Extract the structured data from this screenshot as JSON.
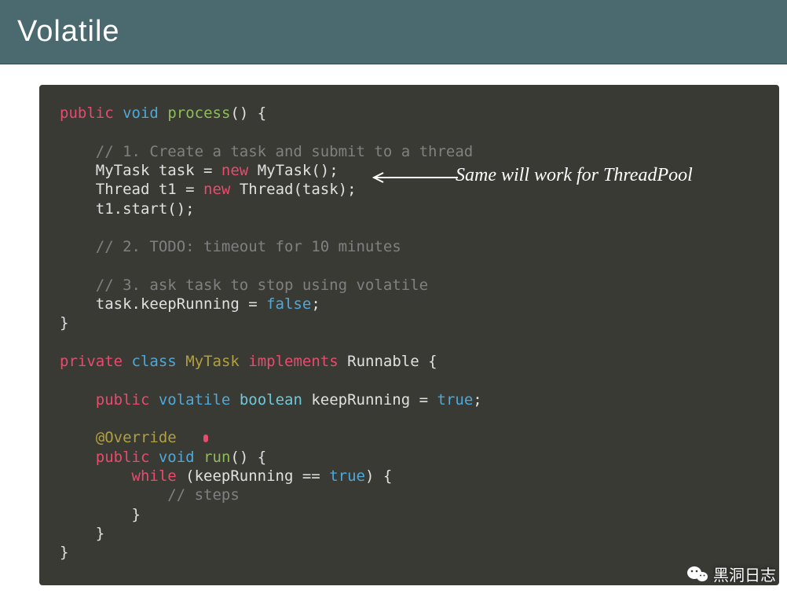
{
  "header": {
    "title": "Volatile"
  },
  "code": {
    "l1": {
      "kw_public": "public",
      "kw_void": "void",
      "fn": "process",
      "tail": "() {"
    },
    "l2": "",
    "l3": {
      "indent": "    ",
      "text": "// 1. Create a task and submit to a thread"
    },
    "l4": {
      "indent": "    ",
      "a": "MyTask task = ",
      "new": "new",
      "b": " MyTask();"
    },
    "l5": {
      "indent": "    ",
      "a": "Thread t1 = ",
      "new": "new",
      "b": " Thread(task);"
    },
    "l6": {
      "indent": "    ",
      "a": "t1.start();"
    },
    "l7": "",
    "l8": {
      "indent": "    ",
      "text": "// 2. TODO: timeout for 10 minutes"
    },
    "l9": "",
    "l10": {
      "indent": "    ",
      "text": "// 3. ask task to stop using volatile"
    },
    "l11": {
      "indent": "    ",
      "a": "task.keepRunning = ",
      "bool": "false",
      "b": ";"
    },
    "l12": "}",
    "l13": "",
    "l14": {
      "kw_private": "private",
      "kw_class": "class",
      "name": "MyTask",
      "kw_impl": "implements",
      "iface": "Runnable {"
    },
    "l15": "",
    "l16": {
      "indent": "    ",
      "kw_public": "public",
      "kw_volatile": "volatile",
      "kw_bool": "boolean",
      "a": " keepRunning = ",
      "bool": "true",
      "b": ";"
    },
    "l17": "",
    "l18": {
      "indent": "    ",
      "anno": "@Override"
    },
    "l19": {
      "indent": "    ",
      "kw_public": "public",
      "kw_void": "void",
      "fn": "run",
      "tail": "() {"
    },
    "l20": {
      "indent": "        ",
      "kw_while": "while",
      "a": " (keepRunning == ",
      "bool": "true",
      "b": ") {"
    },
    "l21": {
      "indent": "            ",
      "text": "// steps"
    },
    "l22": {
      "indent": "        ",
      "a": "}"
    },
    "l23": {
      "indent": "    ",
      "a": "}"
    },
    "l24": "}"
  },
  "annotation": {
    "text": "Same will work for ThreadPool"
  },
  "watermark": {
    "text": "黑洞日志"
  }
}
